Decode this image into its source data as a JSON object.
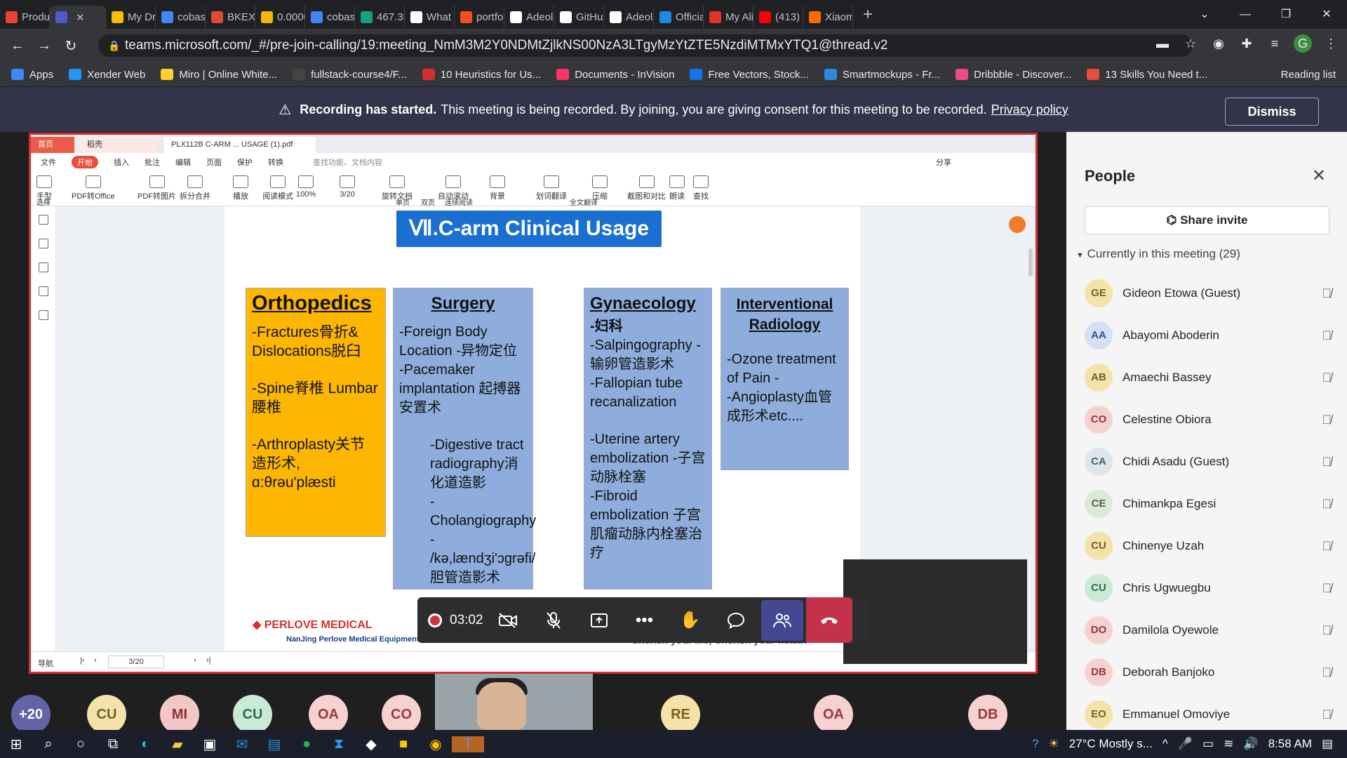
{
  "browser": {
    "tabs": [
      {
        "label": "Produ",
        "color": "#ea4335"
      },
      {
        "label": "",
        "color": "#5059c9"
      },
      {
        "label": "My Dr",
        "color": "#fbbc04"
      },
      {
        "label": "cobas",
        "color": "#4285f4"
      },
      {
        "label": "BKEX",
        "color": "#e34a33"
      },
      {
        "label": "0.0000",
        "color": "#f0b90b"
      },
      {
        "label": "cobas",
        "color": "#4285f4"
      },
      {
        "label": "467.35",
        "color": "#16a085"
      },
      {
        "label": "What",
        "color": "#ffffff"
      },
      {
        "label": "portfo",
        "color": "#f24e1e"
      },
      {
        "label": "Adeola",
        "color": "#ffffff"
      },
      {
        "label": "GitHu",
        "color": "#ffffff"
      },
      {
        "label": "Adeola",
        "color": "#ffffff"
      },
      {
        "label": "Officia",
        "color": "#1e88e5"
      },
      {
        "label": "My Ali",
        "color": "#e43225"
      },
      {
        "label": "(413)",
        "color": "#ff0000"
      },
      {
        "label": "Xiaom",
        "color": "#ff6900"
      }
    ],
    "url": "teams.microsoft.com/_#/pre-join-calling/19:meeting_NmM3M2Y0NDMtZjlkNS00NzA3LTgyMzYtZTE5NzdiMTMxYTQ1@thread.v2",
    "bookmarks": [
      {
        "label": "Apps",
        "color": "#4285f4"
      },
      {
        "label": "Xender Web",
        "color": "#2196f3"
      },
      {
        "label": "Miro | Online White...",
        "color": "#ffd02f"
      },
      {
        "label": "fullstack-course4/F...",
        "color": "#444444"
      },
      {
        "label": "10 Heuristics for Us...",
        "color": "#d32f2f"
      },
      {
        "label": "Documents - InVision",
        "color": "#ff3366"
      },
      {
        "label": "Free Vectors, Stock...",
        "color": "#1273eb"
      },
      {
        "label": "Smartmockups - Fr...",
        "color": "#2e86de"
      },
      {
        "label": "Dribbble - Discover...",
        "color": "#ea4c89"
      },
      {
        "label": "13 Skills You Need t...",
        "color": "#e74c3c"
      }
    ],
    "reading_list": "Reading list",
    "profile_initial": "G"
  },
  "banner": {
    "bold": "Recording has started.",
    "text": "This meeting is being recorded. By joining, you are giving consent for this meeting to be recorded.",
    "link": "Privacy policy",
    "dismiss": "Dismiss"
  },
  "wps": {
    "tab_home": "首页",
    "tab_docer": "稻壳",
    "tab_pdf": "PLX112B C-ARM ... USAGE (1).pdf",
    "menu": [
      "文件",
      "开始",
      "插入",
      "批注",
      "编辑",
      "页面",
      "保护",
      "转换"
    ],
    "search_placeholder": "查找功能、文档内容",
    "share": "分享",
    "tools": [
      "手型",
      "PDF转Office",
      "PDF转图片",
      "拆分合并",
      "播放",
      "阅读模式",
      "100%",
      "3/20",
      "旋转文档",
      "自动滚动",
      "背景",
      "划词翻译",
      "压缩",
      "截图和对比",
      "朗读",
      "查找"
    ],
    "select_tool": "选择",
    "single_page": "单页",
    "double_page": "双页",
    "continuous": "连续阅读",
    "full_translate": "全文翻译",
    "nav": "导航",
    "page_indicator": "3/20",
    "zoom_status": "100%"
  },
  "slide": {
    "title": "Ⅶ.C-arm Clinical Usage",
    "columns": [
      {
        "heading": "Orthopedics",
        "items": [
          "-Fractures骨折& Dislocations脱臼",
          "-Spine脊椎 Lumbar 腰椎",
          "-Arthroplasty关节造形术, ɑ:θrəu'plæsti"
        ]
      },
      {
        "heading": "Surgery",
        "items": [
          "-Foreign Body Location -异物定位",
          "-Pacemaker implantation 起搏器安置术"
        ],
        "sub": [
          "-Digestive tract radiography消化道造影",
          "-Cholangiography - /kə,lændʒi'ɔgrəfi/ 胆管造影术"
        ]
      },
      {
        "heading": "Gynaecology",
        "items": [
          "-妇科",
          "-Salpingography -输卵管造影术",
          "-Fallopian tube recanalization",
          "-Uterine artery embolization -子宫动脉栓塞",
          "-Fibroid embolization 子宫肌瘤动脉内栓塞治疗"
        ]
      },
      {
        "heading": "Interventional Radiology",
        "items": [
          "-Ozone treatment of Pain -",
          "-Angioplasty血管成形术etc...."
        ]
      }
    ],
    "footer_brand": "PERLOVE MEDICAL",
    "footer_sub": "NanJing Perlove Medical Equipment Co.,Ltd",
    "footer_right": "Cherish your life, Cherish your health"
  },
  "callbar": {
    "timer": "03:02"
  },
  "gallery": [
    {
      "initials": "+20",
      "bg": "#6264a7",
      "fg": "#ffffff"
    },
    {
      "initials": "CU",
      "bg": "#f3e2a9",
      "fg": "#7a6020"
    },
    {
      "initials": "MI",
      "bg": "#f4c7c7",
      "fg": "#8a3030"
    },
    {
      "initials": "CU",
      "bg": "#c9ead6",
      "fg": "#2f6d45"
    },
    {
      "initials": "OA",
      "bg": "#f7d1d0",
      "fg": "#943b3b"
    },
    {
      "initials": "CO",
      "bg": "#f7d1d0",
      "fg": "#943b3b"
    },
    {
      "initials": "RE",
      "bg": "#f3e2a9",
      "fg": "#7a6020"
    },
    {
      "initials": "OA",
      "bg": "#f7d1d0",
      "fg": "#943b3b"
    },
    {
      "initials": "DB",
      "bg": "#f7d1d0",
      "fg": "#943b3b"
    }
  ],
  "people_panel": {
    "title": "People",
    "share_invite": "Share invite",
    "currently": "Currently in this meeting (29)",
    "people": [
      {
        "initials": "GE",
        "name": "Gideon Etowa (Guest)",
        "bg": "#f3e2a9",
        "fg": "#7a6020"
      },
      {
        "initials": "AA",
        "name": "Abayomi Aboderin",
        "bg": "#d6e0f5",
        "fg": "#3a4f8a"
      },
      {
        "initials": "AB",
        "name": "Amaechi Bassey",
        "bg": "#f3e2a9",
        "fg": "#7a6020"
      },
      {
        "initials": "CO",
        "name": "Celestine Obiora",
        "bg": "#f7d1d0",
        "fg": "#943b3b"
      },
      {
        "initials": "CA",
        "name": "Chidi Asadu (Guest)",
        "bg": "#dde6ea",
        "fg": "#4d6470"
      },
      {
        "initials": "CE",
        "name": "Chimankpa Egesi",
        "bg": "#dbe9d6",
        "fg": "#4a6b3e"
      },
      {
        "initials": "CU",
        "name": "Chinenye Uzah",
        "bg": "#f3e2a9",
        "fg": "#7a6020"
      },
      {
        "initials": "CU",
        "name": "Chris Ugwuegbu",
        "bg": "#c9ead6",
        "fg": "#2f6d45"
      },
      {
        "initials": "DO",
        "name": "Damilola Oyewole",
        "bg": "#f7d1d0",
        "fg": "#943b3b"
      },
      {
        "initials": "DB",
        "name": "Deborah Banjoko",
        "bg": "#f7d1d0",
        "fg": "#943b3b"
      },
      {
        "initials": "EO",
        "name": "Emmanuel Omoviye",
        "bg": "#f3e2a9",
        "fg": "#7a6020"
      }
    ]
  },
  "taskbar": {
    "weather": "27°C Mostly s...",
    "time": "8:58 AM"
  }
}
